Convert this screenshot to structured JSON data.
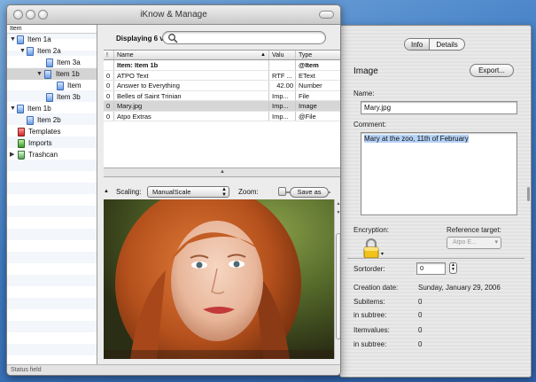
{
  "window": {
    "title": "iKnow & Manage",
    "status": "Status field"
  },
  "outline": {
    "header": "Item",
    "items": [
      {
        "label": "Item 1a",
        "icon": "blue-doc-icon",
        "expanded": true
      },
      {
        "label": "Item 2a",
        "icon": "blue-doc-icon",
        "expanded": true
      },
      {
        "label": "Item 3a",
        "icon": "blue-doc-icon"
      },
      {
        "label": "Item 1b",
        "icon": "blue-doc-icon",
        "expanded": true,
        "selected": true
      },
      {
        "label": "Item",
        "icon": "blue-doc-icon"
      },
      {
        "label": "Item 3b",
        "icon": "blue-doc-icon"
      },
      {
        "label": "Item 1b",
        "icon": "blue-doc-icon",
        "expanded": true
      },
      {
        "label": "Item 2b",
        "icon": "blue-doc-icon"
      },
      {
        "label": "Templates",
        "icon": "red-templates-icon"
      },
      {
        "label": "Imports",
        "icon": "green-imports-icon"
      },
      {
        "label": "Trashcan",
        "icon": "trashcan-icon",
        "collapsed": true
      }
    ]
  },
  "list": {
    "display_text": "Displaying 6 va",
    "search_placeholder": "",
    "columns": [
      "!",
      "Name",
      "Valu",
      "Type"
    ],
    "rows": [
      {
        "flag": "",
        "name": "Item: Item 1b",
        "value": "",
        "type": "@Item",
        "bold": true
      },
      {
        "flag": "0",
        "name": "ATPO Text",
        "value": "RTF ...",
        "type": "EText"
      },
      {
        "flag": "0",
        "name": "Answer to Everything",
        "value": "42.00",
        "type": "Number"
      },
      {
        "flag": "0",
        "name": "Belles of Saint Trinian",
        "value": "Imp...",
        "type": "File"
      },
      {
        "flag": "0",
        "name": "Mary.jpg",
        "value": "Imp...",
        "type": "Image",
        "selected": true
      },
      {
        "flag": "0",
        "name": "Atpo Extras",
        "value": "Imp...",
        "type": "@File"
      }
    ]
  },
  "viewer": {
    "scaling_label": "Scaling:",
    "scaling_value": "ManualScale",
    "zoom_label": "Zoom:",
    "save_as": "Save as"
  },
  "inspector": {
    "tabs": [
      "Info",
      "Details"
    ],
    "active_tab": "Info",
    "kind": "Image",
    "export_label": "Export...",
    "name_label": "Name:",
    "name_value": "Mary.jpg",
    "comment_label": "Comment:",
    "comment_value": "Mary at the zoo, 11th of  February",
    "encryption_label": "Encryption:",
    "reference_label": "Reference target:",
    "reference_value": "Atpo E...",
    "sortorder_label": "Sortorder:",
    "sortorder_value": "0",
    "creation_label": "Creation date:",
    "creation_value": "Sunday, January 29, 2006",
    "subitems_label": "Subitems:",
    "subitems_value": "0",
    "subitems_subtree_label": "in subtree:",
    "subitems_subtree_value": "0",
    "itemvalues_label": "Itemvalues:",
    "itemvalues_value": "0",
    "itemvalues_subtree_label": "in subtree:",
    "itemvalues_subtree_value": "0"
  }
}
